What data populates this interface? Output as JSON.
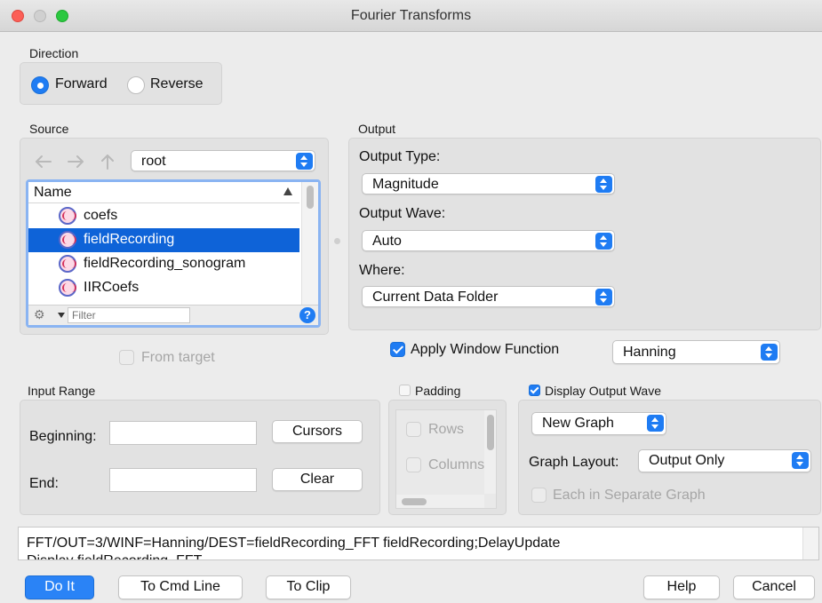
{
  "window": {
    "title": "Fourier Transforms"
  },
  "direction": {
    "label": "Direction",
    "options": [
      "Forward",
      "Reverse"
    ],
    "selected": "Forward"
  },
  "source": {
    "label": "Source",
    "folder": "root",
    "column_header": "Name",
    "items": [
      "coefs",
      "fieldRecording",
      "fieldRecording_sonogram",
      "IIRCoefs"
    ],
    "selected": "fieldRecording",
    "filter_placeholder": "Filter",
    "help_glyph": "?",
    "from_target_label": "From target",
    "from_target_checked": false
  },
  "output": {
    "label": "Output",
    "type_label": "Output Type:",
    "type_value": "Magnitude",
    "wave_label": "Output Wave:",
    "wave_value": "Auto",
    "where_label": "Where:",
    "where_value": "Current Data Folder"
  },
  "window_function": {
    "label": "Apply Window Function",
    "checked": true,
    "value": "Hanning"
  },
  "input_range": {
    "label": "Input Range",
    "beginning_label": "Beginning:",
    "beginning_value": "",
    "end_label": "End:",
    "end_value": "",
    "cursors_button": "Cursors",
    "clear_button": "Clear"
  },
  "padding": {
    "label": "Padding",
    "checked": false,
    "items": [
      "Rows",
      "Columns"
    ]
  },
  "display": {
    "label": "Display Output Wave",
    "checked": true,
    "graph_value": "New Graph",
    "layout_label": "Graph Layout:",
    "layout_value": "Output Only",
    "separate_label": "Each in Separate Graph",
    "separate_checked": false
  },
  "command": {
    "line1": "FFT/OUT=3/WINF=Hanning/DEST=fieldRecording_FFT  fieldRecording;DelayUpdate",
    "line2": "Display fieldRecording_FFT"
  },
  "buttons": {
    "do_it": "Do It",
    "to_cmd_line": "To Cmd Line",
    "to_clip": "To Clip",
    "help": "Help",
    "cancel": "Cancel"
  },
  "colors": {
    "accent": "#1f7cf3",
    "selection": "#0e63d8",
    "panel": "#e2e2e2"
  }
}
